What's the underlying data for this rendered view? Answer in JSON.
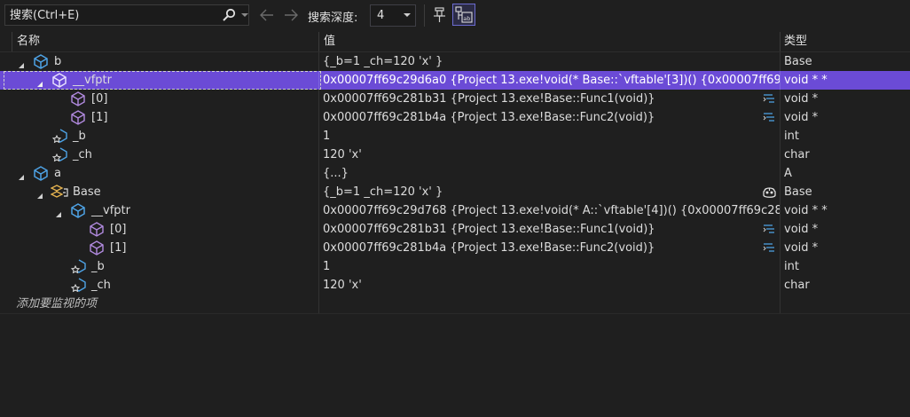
{
  "toolbar": {
    "search_placeholder": "搜索(Ctrl+E)",
    "depth_label": "搜索深度:",
    "depth_value": "4"
  },
  "columns": {
    "name": "名称",
    "value": "值",
    "type": "类型"
  },
  "rows": [
    {
      "name": "b",
      "value": "{_b=1 _ch=120 'x' }",
      "type": "Base"
    },
    {
      "name": "__vfptr",
      "value": "0x00007ff69c29d6a0 {Project 13.exe!void(* Base::`vftable'[3])() {0x00007ff69...",
      "type": "void * *"
    },
    {
      "name": "[0]",
      "value": "0x00007ff69c281b31 {Project 13.exe!Base::Func1(void)}",
      "type": "void *"
    },
    {
      "name": "[1]",
      "value": "0x00007ff69c281b4a {Project 13.exe!Base::Func2(void)}",
      "type": "void *"
    },
    {
      "name": "_b",
      "value": "1",
      "type": "int"
    },
    {
      "name": "_ch",
      "value": "120 'x'",
      "type": "char"
    },
    {
      "name": "a",
      "value": "{...}",
      "type": "A"
    },
    {
      "name": "Base",
      "value": "{_b=1 _ch=120 'x' }",
      "type": "Base"
    },
    {
      "name": "__vfptr",
      "value": "0x00007ff69c29d768 {Project 13.exe!void(* A::`vftable'[4])() {0x00007ff69c28...",
      "type": "void * *"
    },
    {
      "name": "[0]",
      "value": "0x00007ff69c281b31 {Project 13.exe!Base::Func1(void)}",
      "type": "void *"
    },
    {
      "name": "[1]",
      "value": "0x00007ff69c281b4a {Project 13.exe!Base::Func2(void)}",
      "type": "void *"
    },
    {
      "name": "_b",
      "value": "1",
      "type": "int"
    },
    {
      "name": "_ch",
      "value": "120 'x'",
      "type": "char"
    }
  ],
  "add_watch_placeholder": "添加要监视的项",
  "colors": {
    "selected_row": "#6b4bd6",
    "accent": "#6b6bcf"
  }
}
